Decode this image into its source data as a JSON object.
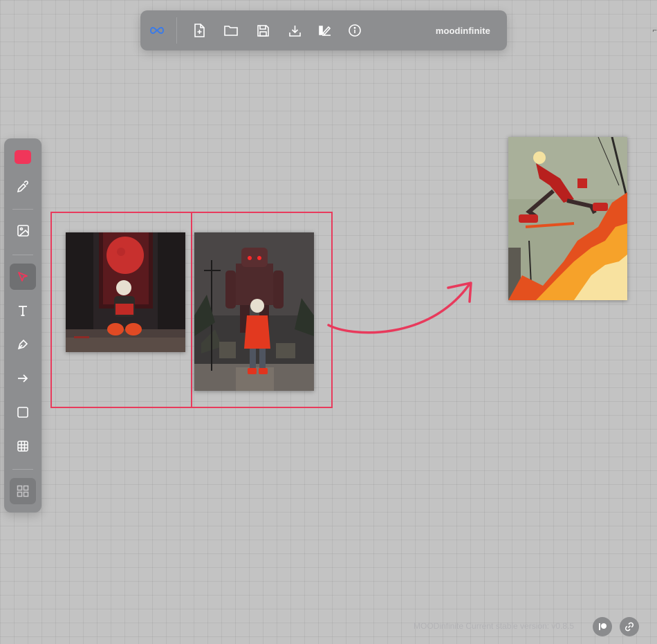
{
  "app": {
    "brand": "moodinfinite",
    "version_text": "MOODinfinite Current stable version: v0.8.5"
  },
  "toolbar": {
    "items": [
      {
        "icon": "infinity-icon",
        "color": "#3b7be8"
      },
      {
        "icon": "new-file-icon"
      },
      {
        "icon": "open-folder-icon"
      },
      {
        "icon": "save-icon"
      },
      {
        "icon": "download-icon"
      },
      {
        "icon": "background-edit-icon"
      },
      {
        "icon": "info-icon"
      }
    ]
  },
  "tools": {
    "active_color": "#f0365a",
    "items": [
      {
        "icon": "color-swatch"
      },
      {
        "icon": "eyedropper-icon"
      },
      {
        "icon": "image-icon"
      },
      {
        "icon": "pointer-icon",
        "active": true
      },
      {
        "icon": "text-icon"
      },
      {
        "icon": "pen-icon"
      },
      {
        "icon": "arrow-icon"
      },
      {
        "icon": "rectangle-icon"
      },
      {
        "icon": "table-grid-icon"
      },
      {
        "icon": "grid-view-icon"
      }
    ]
  },
  "footer": {
    "buttons": [
      {
        "icon": "patreon-icon"
      },
      {
        "icon": "link-icon"
      }
    ]
  },
  "colors": {
    "canvas": "#c3c3c3",
    "panel": "#8d8e90",
    "accent": "#e83a5c"
  }
}
